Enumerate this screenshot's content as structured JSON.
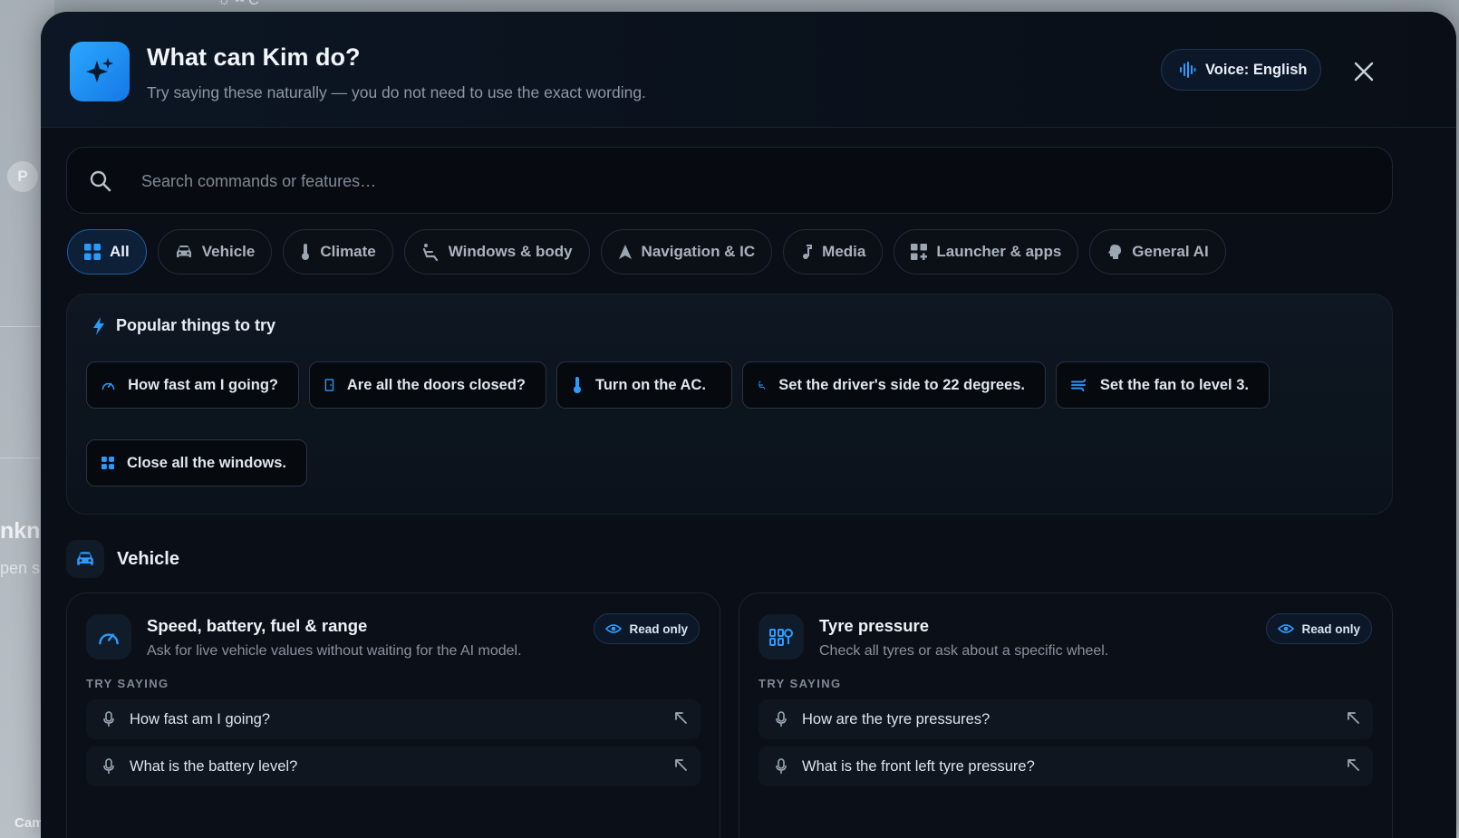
{
  "background": {
    "top_text": "☼ -- C",
    "avatar_letter": "P",
    "partial_title": "nkn",
    "partial_sub": "pen s",
    "partial_cam": "Cam"
  },
  "modal": {
    "title": "What can Kim do?",
    "subtitle": "Try saying these naturally — you do not need to use the exact wording.",
    "voice_label": "Voice: English"
  },
  "search": {
    "placeholder": "Search commands or features…",
    "value": ""
  },
  "filters": [
    {
      "label": "All",
      "icon": "grid-icon",
      "active": true
    },
    {
      "label": "Vehicle",
      "icon": "car-icon",
      "active": false
    },
    {
      "label": "Climate",
      "icon": "thermometer-icon",
      "active": false
    },
    {
      "label": "Windows & body",
      "icon": "seat-icon",
      "active": false
    },
    {
      "label": "Navigation & IC",
      "icon": "navigation-icon",
      "active": false
    },
    {
      "label": "Media",
      "icon": "music-note-icon",
      "active": false
    },
    {
      "label": "Launcher & apps",
      "icon": "apps-icon",
      "active": false
    },
    {
      "label": "General AI",
      "icon": "brain-icon",
      "active": false
    }
  ],
  "popular": {
    "title": "Popular things to try",
    "items": [
      {
        "label": "How fast am I going?",
        "icon": "speedometer-icon"
      },
      {
        "label": "Are all the doors closed?",
        "icon": "door-icon"
      },
      {
        "label": "Turn on the AC.",
        "icon": "thermometer-icon"
      },
      {
        "label": "Set the driver's side to 22 degrees.",
        "icon": "seat-icon"
      },
      {
        "label": "Set the fan to level 3.",
        "icon": "fan-icon"
      },
      {
        "label": "Close all the windows.",
        "icon": "windows-icon"
      }
    ]
  },
  "section": {
    "title": "Vehicle"
  },
  "cards": [
    {
      "title": "Speed, battery, fuel & range",
      "description": "Ask for live vehicle values without waiting for the AI model.",
      "badge": "Read only",
      "try_label": "TRY SAYING",
      "phrases": [
        "How fast am I going?",
        "What is the battery level?"
      ]
    },
    {
      "title": "Tyre pressure",
      "description": "Check all tyres or ask about a specific wheel.",
      "badge": "Read only",
      "try_label": "TRY SAYING",
      "phrases": [
        "How are the tyre pressures?",
        "What is the front left tyre pressure?"
      ]
    }
  ],
  "colors": {
    "accent": "#2a9bff",
    "modal_bg": "#0a0f17",
    "active_chip_bg": "#0d2038"
  }
}
